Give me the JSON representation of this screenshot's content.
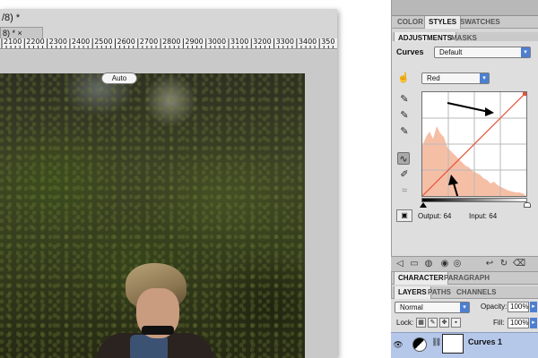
{
  "document": {
    "title": "/8) *",
    "tab_label": "8) * ×",
    "ruler_labels": [
      "2100",
      "2200",
      "2300",
      "2400",
      "2500",
      "2600",
      "2700",
      "2800",
      "2900",
      "3000",
      "3100",
      "3200",
      "3300",
      "3400",
      "350"
    ]
  },
  "top_panel": {
    "tabs": [
      "COLOR",
      "STYLES",
      "SWATCHES"
    ],
    "active_tab": "STYLES"
  },
  "adjustments_panel": {
    "tabs": [
      "ADJUSTMENTS",
      "MASKS"
    ],
    "active_tab": "ADJUSTMENTS",
    "adjustment_type": "Curves",
    "preset": "Default",
    "channel": "Red",
    "auto_label": "Auto",
    "output_label": "Output: 64",
    "input_label": "Input: 64",
    "curve_color": "#e8543a",
    "histogram_color": "#f5bfa6",
    "tool_icons": [
      "curve-point-icon",
      "eyedropper-black-icon",
      "eyedropper-gray-icon",
      "eyedropper-white-icon",
      "curve-edit-icon",
      "pencil-icon",
      "smooth-icon"
    ]
  },
  "character_panel": {
    "tabs": [
      "CHARACTER",
      "PARAGRAPH"
    ],
    "active_tab": "CHARACTER"
  },
  "layers_panel": {
    "tabs": [
      "LAYERS",
      "PATHS",
      "CHANNELS"
    ],
    "active_tab": "LAYERS",
    "blend_mode": "Normal",
    "opacity_label": "Opacity:",
    "opacity_value": "100%",
    "lock_label": "Lock:",
    "fill_label": "Fill:",
    "fill_value": "100%",
    "layer_name": "Curves 1",
    "selected_row_color": "#b5c8ea"
  }
}
